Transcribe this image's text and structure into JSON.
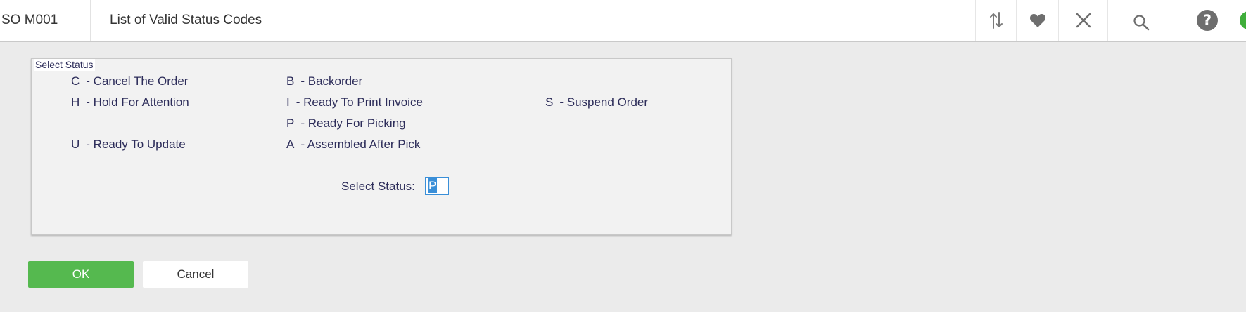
{
  "header": {
    "screen_code": "SO M001",
    "title": "List of Valid Status Codes",
    "icons": [
      "sort-arrows-icon",
      "heart-icon",
      "close-icon",
      "search-icon",
      "help-icon",
      "status-dot-icon"
    ],
    "status_dot_color": "#3fae3a"
  },
  "panel": {
    "legend": "Select Status",
    "codes": [
      {
        "key": "C",
        "label": "- Cancel The Order"
      },
      {
        "key": "B",
        "label": "- Backorder"
      },
      {
        "key": "H",
        "label": "- Hold For Attention"
      },
      {
        "key": "I",
        "label": "- Ready To Print Invoice"
      },
      {
        "key": "S",
        "label": "- Suspend Order"
      },
      {
        "key": "P",
        "label": "- Ready For Picking"
      },
      {
        "key": "U",
        "label": "- Ready To Update"
      },
      {
        "key": "A",
        "label": "- Assembled After Pick"
      }
    ],
    "select_label": "Select Status:",
    "select_value": "P"
  },
  "buttons": {
    "ok": "OK",
    "cancel": "Cancel"
  },
  "colors": {
    "accent": "#55b94f",
    "text": "#2d2d5a",
    "background": "#ebebeb"
  }
}
